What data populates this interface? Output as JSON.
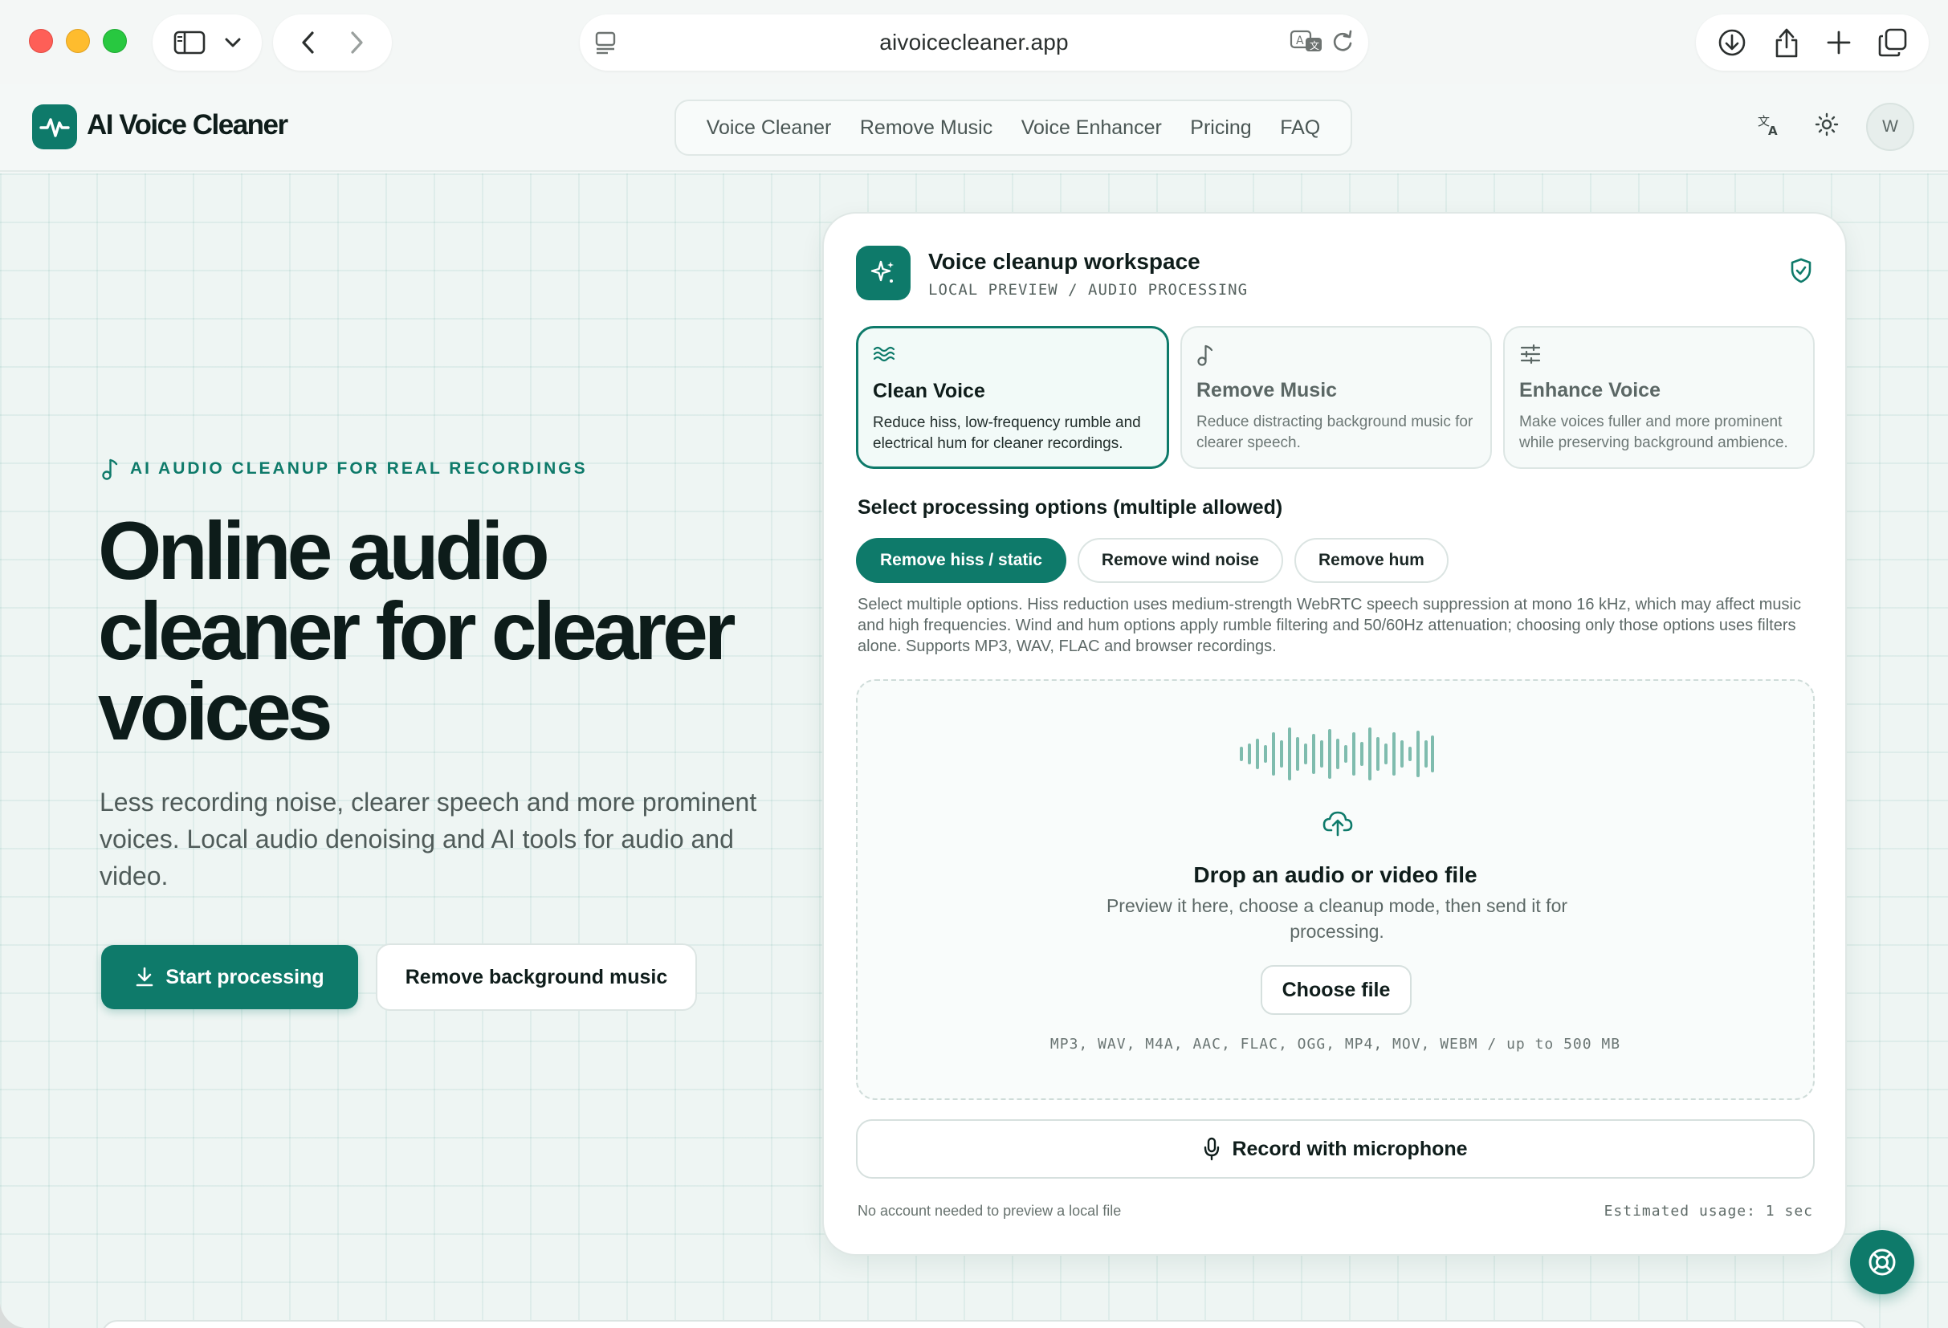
{
  "browser": {
    "url": "aivoicecleaner.app"
  },
  "site": {
    "brand": "AI Voice Cleaner",
    "nav": [
      "Voice Cleaner",
      "Remove Music",
      "Voice Enhancer",
      "Pricing",
      "FAQ"
    ],
    "avatar_initial": "W"
  },
  "hero": {
    "eyebrow": "AI AUDIO CLEANUP FOR REAL RECORDINGS",
    "title": "Online audio cleaner for clearer voices",
    "subtitle": "Less recording noise, clearer speech and more prominent voices. Local audio denoising and AI tools for audio and video.",
    "primary_cta": "Start processing",
    "secondary_cta": "Remove background music"
  },
  "workspace": {
    "title": "Voice cleanup workspace",
    "subtitle": "LOCAL PREVIEW / AUDIO PROCESSING",
    "modes": [
      {
        "title": "Clean Voice",
        "desc": "Reduce hiss, low-frequency rumble and electrical hum for cleaner recordings.",
        "icon": "waves-icon",
        "selected": true
      },
      {
        "title": "Remove Music",
        "desc": "Reduce distracting background music for clearer speech.",
        "icon": "music-note-icon",
        "selected": false
      },
      {
        "title": "Enhance Voice",
        "desc": "Make voices fuller and more prominent while preserving background ambience.",
        "icon": "sliders-icon",
        "selected": false
      }
    ],
    "options_label": "Select processing options (multiple allowed)",
    "options": [
      {
        "label": "Remove hiss / static",
        "selected": true
      },
      {
        "label": "Remove wind noise",
        "selected": false
      },
      {
        "label": "Remove hum",
        "selected": false
      }
    ],
    "options_help": "Select multiple options. Hiss reduction uses medium-strength WebRTC speech suppression at mono 16 kHz, which may affect music and high frequencies. Wind and hum options apply rumble filtering and 50/60Hz attenuation; choosing only those options uses filters alone. Supports MP3, WAV, FLAC and browser recordings.",
    "drop": {
      "title": "Drop an audio or video file",
      "desc": "Preview it here, choose a cleanup mode, then send it for processing.",
      "button": "Choose file",
      "formats": "MP3, WAV, M4A, AAC, FLAC, OGG, MP4, MOV, WEBM / up to 500 MB"
    },
    "record_button": "Record with microphone",
    "footer_left": "No account needed to preview a local file",
    "footer_right": "Estimated usage: 1 sec"
  },
  "colors": {
    "accent": "#0e7a6a",
    "background": "#eef5f3"
  }
}
